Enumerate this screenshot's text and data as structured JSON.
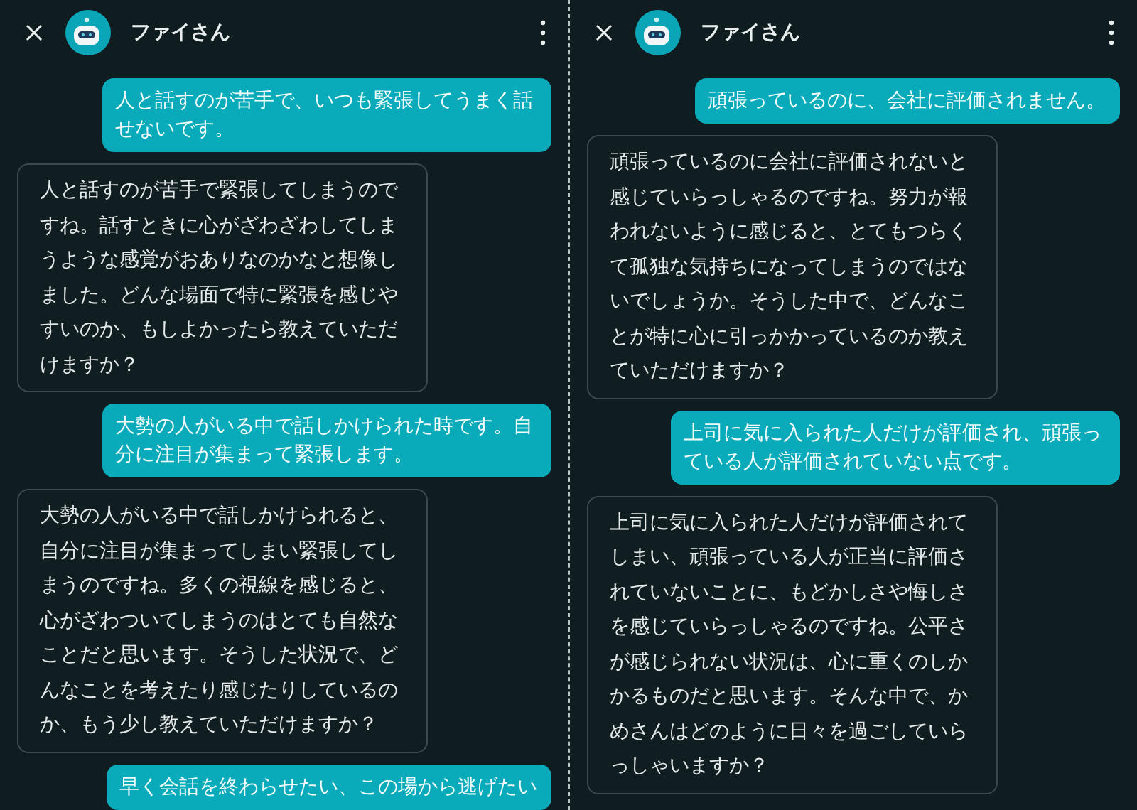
{
  "panels": [
    {
      "header": {
        "name": "ファイさん"
      },
      "messages": [
        {
          "kind": "user",
          "text": "人と話すのが苦手で、いつも緊張してうまく話せないです。"
        },
        {
          "kind": "bot",
          "text": "人と話すのが苦手で緊張してしまうのですね。話すときに心がざわざわしてしまうような感覚がおありなのかなと想像しました。どんな場面で特に緊張を感じやすいのか、もしよかったら教えていただけますか？"
        },
        {
          "kind": "user",
          "text": "大勢の人がいる中で話しかけられた時です。自分に注目が集まって緊張します。"
        },
        {
          "kind": "bot",
          "text": "大勢の人がいる中で話しかけられると、自分に注目が集まってしまい緊張してしまうのですね。多くの視線を感じると、心がざわついてしまうのはとても自然なことだと思います。そうした状況で、どんなことを考えたり感じたりしているのか、もう少し教えていただけますか？"
        },
        {
          "kind": "user",
          "text": "早く会話を終わらせたい、この場から逃げたい"
        }
      ]
    },
    {
      "header": {
        "name": "ファイさん"
      },
      "messages": [
        {
          "kind": "user",
          "text": "頑張っているのに、会社に評価されません。"
        },
        {
          "kind": "bot",
          "text": "頑張っているのに会社に評価されないと感じていらっしゃるのですね。努力が報われないように感じると、とてもつらくて孤独な気持ちになってしまうのではないでしょうか。そうした中で、どんなことが特に心に引っかかっているのか教えていただけますか？"
        },
        {
          "kind": "user",
          "text": "上司に気に入られた人だけが評価され、頑張っている人が評価されていない点です。"
        },
        {
          "kind": "bot",
          "text": "上司に気に入られた人だけが評価されてしまい、頑張っている人が正当に評価されていないことに、もどかしさや悔しさを感じていらっしゃるのですね。公平さが感じられない状況は、心に重くのしかかるものだと思います。そんな中で、かめさんはどのように日々を過ごしていらっしゃいますか？"
        }
      ]
    }
  ]
}
